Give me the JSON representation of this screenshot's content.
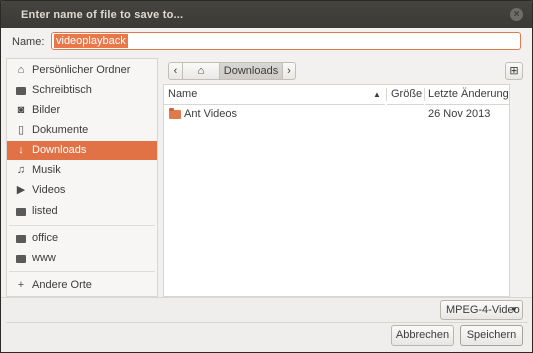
{
  "window": {
    "title": "Enter name of file to save to..."
  },
  "name_field": {
    "label": "Name:",
    "value": "videoplayback"
  },
  "sidebar": {
    "items": [
      {
        "label": "Persönlicher Ordner",
        "icon": "home-icon"
      },
      {
        "label": "Schreibtisch",
        "icon": "folder-icon"
      },
      {
        "label": "Bilder",
        "icon": "camera-icon"
      },
      {
        "label": "Dokumente",
        "icon": "document-icon"
      },
      {
        "label": "Downloads",
        "icon": "download-icon",
        "active": true
      },
      {
        "label": "Musik",
        "icon": "music-icon"
      },
      {
        "label": "Videos",
        "icon": "video-icon"
      },
      {
        "label": "listed",
        "icon": "folder-icon"
      }
    ],
    "bookmarks": [
      {
        "label": "office",
        "icon": "folder-icon"
      },
      {
        "label": "www",
        "icon": "folder-icon"
      }
    ],
    "other": {
      "label": "Andere Orte",
      "icon": "plus-icon"
    }
  },
  "pathbar": {
    "back_icon": "chevron-left-icon",
    "home_icon": "home-icon",
    "current": "Downloads",
    "forward_icon": "chevron-right-icon"
  },
  "file_list": {
    "columns": {
      "name": "Name",
      "size": "Größe",
      "modified": "Letzte Änderung"
    },
    "rows": [
      {
        "name": "Ant Videos",
        "size": "",
        "modified": "26 Nov 2013",
        "icon": "folder-icon"
      }
    ]
  },
  "filter": {
    "selected": "MPEG-4-Video"
  },
  "buttons": {
    "cancel": "Abbrechen",
    "save": "Speichern"
  },
  "colors": {
    "accent": "#e07246",
    "titlebar": "#3c3b37"
  }
}
